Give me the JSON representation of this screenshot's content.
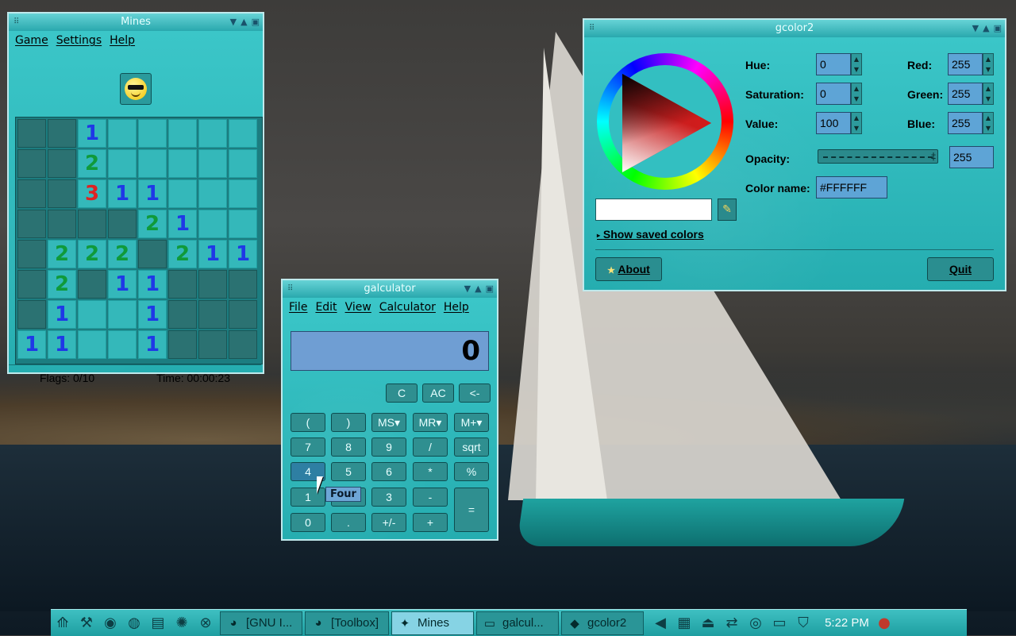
{
  "mines": {
    "title": "Mines",
    "menu": [
      "Game",
      "Settings",
      "Help"
    ],
    "grid": [
      [
        "c",
        "c",
        "1",
        "o",
        "o",
        "o",
        "o",
        "o"
      ],
      [
        "c",
        "c",
        "2",
        "o",
        "o",
        "o",
        "o",
        "o"
      ],
      [
        "c",
        "c",
        "3",
        "1",
        "1",
        "o",
        "o",
        "o"
      ],
      [
        "c",
        "c",
        "c",
        "c",
        "2",
        "1",
        "o",
        "o"
      ],
      [
        "c",
        "2",
        "2",
        "2",
        "c",
        "2",
        "1",
        "1"
      ],
      [
        "c",
        "2",
        "c",
        "1",
        "1",
        "c",
        "c",
        "c"
      ],
      [
        "c",
        "1",
        "o",
        "o",
        "1",
        "c",
        "c",
        "c"
      ],
      [
        "1",
        "1",
        "o",
        "o",
        "1",
        "c",
        "c",
        "c"
      ]
    ],
    "flags": "Flags: 0/10",
    "time": "Time: 00:00:23"
  },
  "calculator": {
    "title": "galculator",
    "menu": [
      "File",
      "Edit",
      "View",
      "Calculator",
      "Help"
    ],
    "display": "0",
    "tooltip": "Four",
    "buttons": {
      "c": "C",
      "ac": "AC",
      "back": "<-",
      "lparen": "(",
      "rparen": ")",
      "ms": "MS▾",
      "mr": "MR▾",
      "mplus": "M+▾",
      "b7": "7",
      "b8": "8",
      "b9": "9",
      "div": "/",
      "sqrt": "sqrt",
      "b4": "4",
      "b5": "5",
      "b6": "6",
      "mul": "*",
      "pct": "%",
      "b1": "1",
      "b2": "2",
      "b3": "3",
      "minus": "-",
      "eq": "=",
      "b0": "0",
      "dot": ".",
      "sign": "+/-",
      "plus": "+"
    }
  },
  "gcolor": {
    "title": "gcolor2",
    "hue_label": "Hue:",
    "hue": "0",
    "sat_label": "Saturation:",
    "sat": "0",
    "val_label": "Value:",
    "val": "100",
    "red_label": "Red:",
    "red": "255",
    "green_label": "Green:",
    "green": "255",
    "blue_label": "Blue:",
    "blue": "255",
    "opacity_label": "Opacity:",
    "opacity": "255",
    "name_label": "Color name:",
    "name": "#FFFFFF",
    "saved": "Show saved colors",
    "about": "About",
    "quit": "Quit",
    "swatch_color": "#FFFFFF"
  },
  "taskbar": {
    "tasks": [
      "[GNU I...",
      "[Toolbox]",
      "Mines",
      "galcul...",
      "gcolor2"
    ],
    "clock": "5:22 PM"
  }
}
